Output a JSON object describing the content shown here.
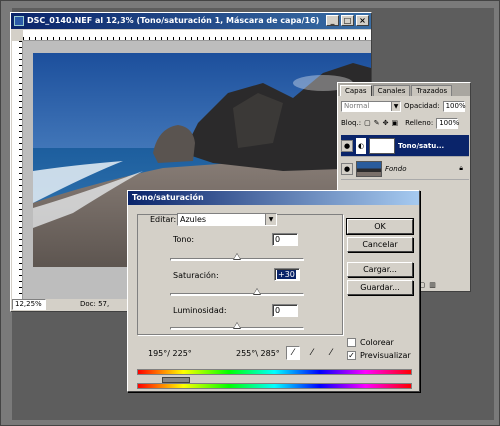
{
  "document": {
    "title": "DSC_0140.NEF al 12,3% (Tono/saturación 1, Máscara de capa/16)",
    "zoom": "12,25%",
    "doc_info": "Doc: 57,"
  },
  "layers_panel": {
    "tabs": [
      "Capas",
      "Canales",
      "Trazados"
    ],
    "blend_mode": "Normal",
    "opacity_label": "Opacidad:",
    "opacity_value": "100%",
    "lock_label": "Bloq.:",
    "fill_label": "Relleno:",
    "fill_value": "100%",
    "layers": [
      {
        "name": "Tono/satu...",
        "selected": true
      },
      {
        "name": "Fondo",
        "selected": false
      }
    ]
  },
  "dialog": {
    "title": "Tono/saturación",
    "edit_label": "Editar:",
    "edit_value": "Azules",
    "hue_label": "Tono:",
    "hue_value": "0",
    "saturation_label": "Saturación:",
    "saturation_value": "+30",
    "lightness_label": "Luminosidad:",
    "lightness_value": "0",
    "ok_label": "OK",
    "cancel_label": "Cancelar",
    "load_label": "Cargar...",
    "save_label": "Guardar...",
    "colorize_label": "Colorear",
    "preview_label": "Previsualizar",
    "colorize_checked": false,
    "preview_checked": true,
    "range_left": "195°/ 225°",
    "range_right": "255°\\ 285°"
  },
  "colors": {
    "title_active": "#0a246a",
    "panel_bg": "#d4d0c8"
  }
}
